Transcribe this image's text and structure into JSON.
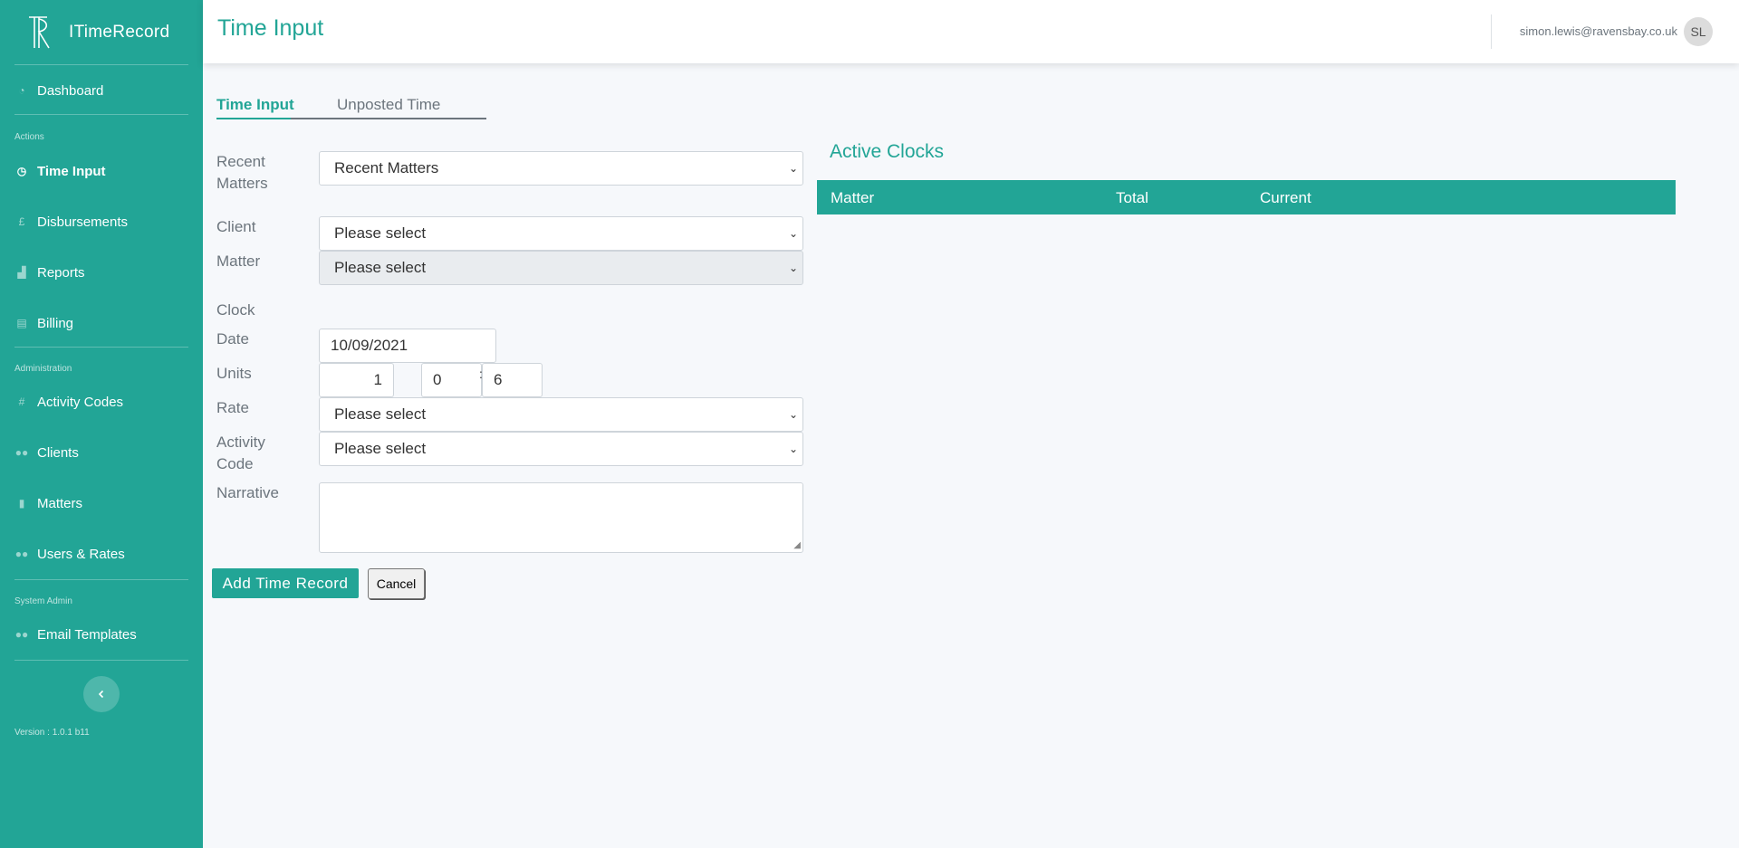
{
  "brand": {
    "name": "ITimeRecord"
  },
  "sidebar": {
    "items": [
      {
        "label": "Dashboard",
        "icon": "dashboard-icon"
      },
      {
        "label": "Time Input",
        "icon": "clock-icon"
      },
      {
        "label": "Disbursements",
        "icon": "pound-icon"
      },
      {
        "label": "Reports",
        "icon": "chart-icon"
      },
      {
        "label": "Billing",
        "icon": "file-icon"
      },
      {
        "label": "Activity Codes",
        "icon": "hash-icon"
      },
      {
        "label": "Clients",
        "icon": "users-icon"
      },
      {
        "label": "Matters",
        "icon": "book-icon"
      },
      {
        "label": "Users & Rates",
        "icon": "users-icon"
      },
      {
        "label": "Email Templates",
        "icon": "users-icon"
      }
    ],
    "headings": {
      "actions": "Actions",
      "administration": "Administration",
      "system_admin": "System Admin"
    },
    "version": "Version : 1.0.1 b11"
  },
  "header": {
    "title": "Time Input",
    "user_email": "simon.lewis@ravensbay.co.uk",
    "avatar_initials": "SL"
  },
  "tabs": [
    {
      "label": "Time Input",
      "active": true
    },
    {
      "label": "Unposted Time",
      "active": false
    }
  ],
  "form": {
    "recent_matters": {
      "label_line1": "Recent",
      "label_line2": "Matters",
      "value": "Recent Matters"
    },
    "client": {
      "label": "Client",
      "value": "Please select"
    },
    "matter": {
      "label": "Matter",
      "value": "Please select"
    },
    "clock": {
      "label": "Clock"
    },
    "date": {
      "label": "Date",
      "value": "10/09/2021"
    },
    "units": {
      "label": "Units",
      "value": "1",
      "hours": "0",
      "minutes": "6",
      "separator": ":"
    },
    "rate": {
      "label": "Rate",
      "value": "Please select"
    },
    "activity_code": {
      "label_line1": "Activity",
      "label_line2": "Code",
      "value": "Please select"
    },
    "narrative": {
      "label": "Narrative",
      "value": ""
    },
    "submit_label": "Add Time Record",
    "cancel_label": "Cancel"
  },
  "active_clocks": {
    "title": "Active Clocks",
    "columns": [
      "Matter",
      "Total",
      "Current"
    ],
    "rows": []
  },
  "colors": {
    "accent": "#22a596",
    "background": "#f6f8fb"
  }
}
